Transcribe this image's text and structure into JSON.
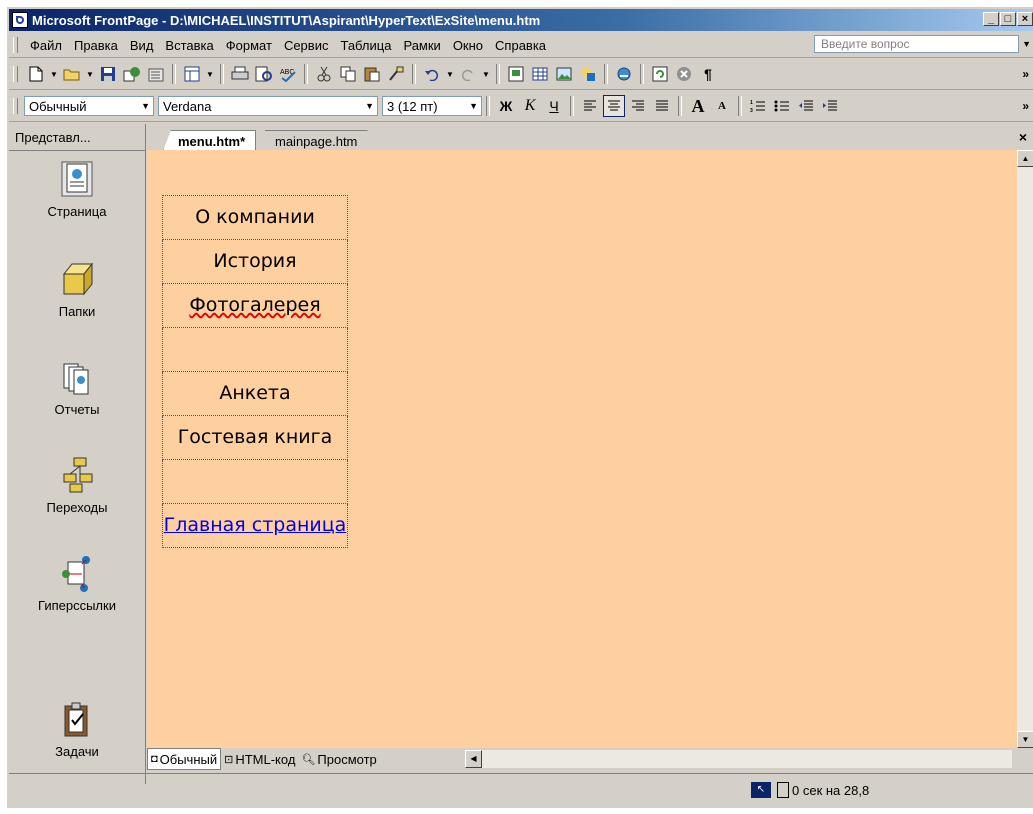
{
  "window": {
    "title": "Microsoft FrontPage - D:\\MICHAEL\\INSTITUT\\Aspirant\\HyperText\\ExSite\\menu.htm",
    "buttons": [
      "_",
      "□",
      "×"
    ]
  },
  "menu": {
    "items": [
      "Файл",
      "Правка",
      "Вид",
      "Вставка",
      "Формат",
      "Сервис",
      "Таблица",
      "Рамки",
      "Окно",
      "Справка"
    ],
    "question_placeholder": "Введите вопрос"
  },
  "format_toolbar": {
    "style": "Обычный",
    "font": "Verdana",
    "size": "3 (12 пт)",
    "bold": "Ж",
    "italic": "К",
    "underline": "Ч"
  },
  "views": {
    "header": "Представл...",
    "items": [
      "Страница",
      "Папки",
      "Отчеты",
      "Переходы",
      "Гиперссылки",
      "Задачи"
    ]
  },
  "tabs": [
    "menu.htm*",
    "mainpage.htm"
  ],
  "page": {
    "cells": [
      "О компании",
      "История",
      "Фотогалерея",
      "",
      "Анкета",
      "Гостевая книга",
      "",
      "Главная страница"
    ]
  },
  "modes": [
    "Обычный",
    "HTML-код",
    "Просмотр"
  ],
  "status": {
    "time": "0 сек на 28,8"
  },
  "colors": {
    "canvas_bg": "#fecf9f",
    "title_start": "#0a246a",
    "link": "#0000ee"
  }
}
